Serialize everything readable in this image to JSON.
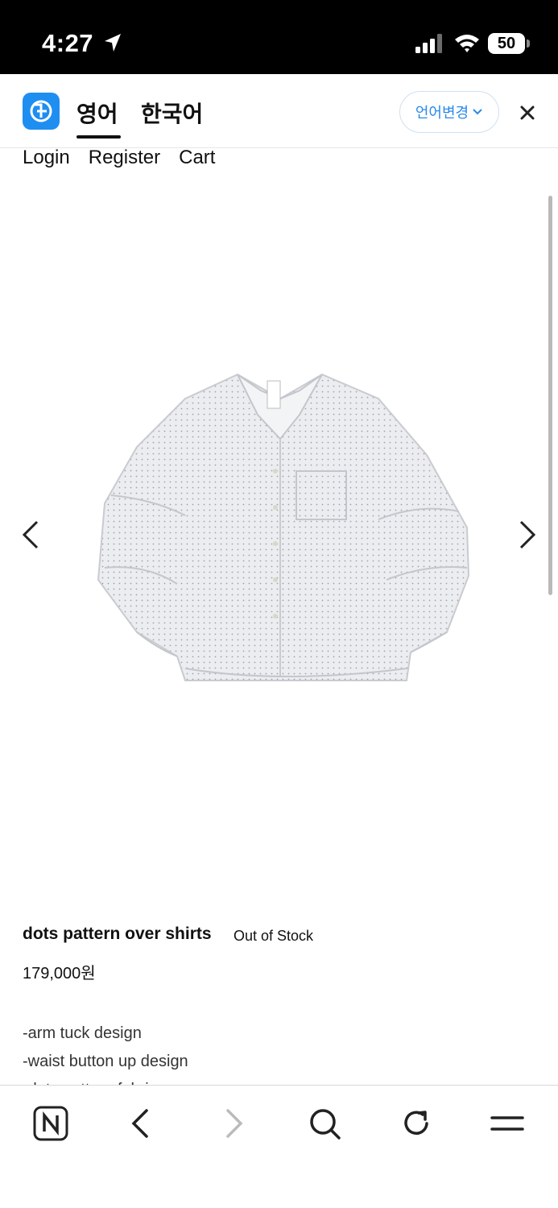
{
  "status_bar": {
    "time": "4:27",
    "battery": "50"
  },
  "translation_bar": {
    "tabs": [
      {
        "label": "영어",
        "active": true
      },
      {
        "label": "한국어",
        "active": false
      }
    ],
    "change_language_label": "언어변경"
  },
  "site_nav": {
    "items": [
      "Login",
      "Register",
      "Cart"
    ]
  },
  "product": {
    "name": "dots pattern over shirts",
    "stock_status": "Out of Stock",
    "price": "179,000원",
    "description": [
      "-arm tuck design",
      "-waist button up design",
      "-dots pattern fabric"
    ]
  },
  "icons": {
    "location": "location-arrow-icon",
    "signal": "cellular-signal-icon",
    "wifi": "wifi-icon",
    "translate_logo": "translate-logo-icon",
    "close": "close-icon",
    "prev": "chevron-left-icon",
    "next": "chevron-right-icon",
    "naver": "naver-n-icon",
    "back": "back-icon",
    "forward": "forward-icon",
    "search": "search-icon",
    "reload": "reload-icon",
    "menu": "menu-icon"
  },
  "colors": {
    "status_bar_bg": "#000000",
    "accent_blue": "#2a8ae8",
    "logo_blue": "#1f8ef1"
  }
}
